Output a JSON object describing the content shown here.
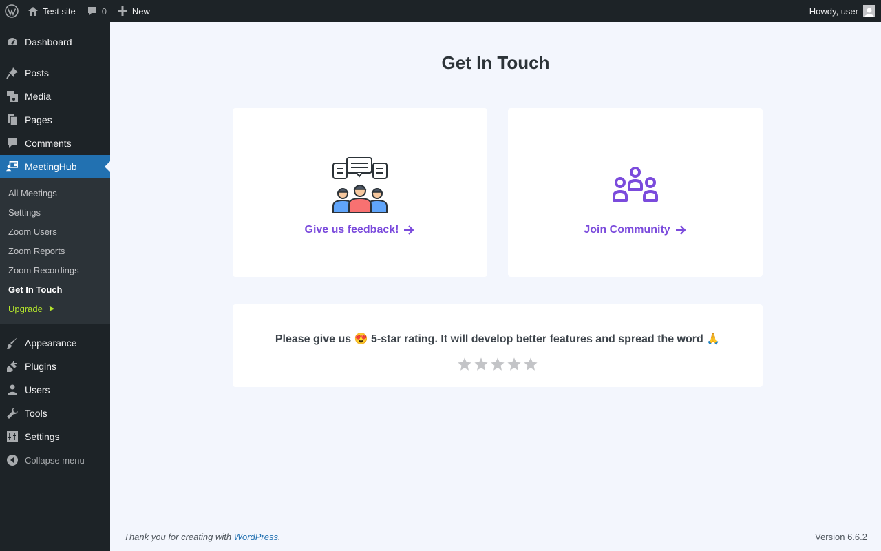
{
  "adminbar": {
    "site_name": "Test site",
    "comments_count": "0",
    "new_label": "New",
    "howdy": "Howdy, user"
  },
  "sidebar": {
    "items_top": [
      {
        "label": "Dashboard",
        "icon": "dashboard-icon"
      }
    ],
    "items_mid": [
      {
        "label": "Posts",
        "icon": "pin-icon"
      },
      {
        "label": "Media",
        "icon": "media-icon"
      },
      {
        "label": "Pages",
        "icon": "pages-icon"
      },
      {
        "label": "Comments",
        "icon": "comment-icon"
      },
      {
        "label": "MeetingHub",
        "icon": "meetinghub-icon"
      }
    ],
    "submenu": [
      {
        "label": "All Meetings"
      },
      {
        "label": "Settings"
      },
      {
        "label": "Zoom Users"
      },
      {
        "label": "Zoom Reports"
      },
      {
        "label": "Zoom Recordings"
      },
      {
        "label": "Get In Touch"
      },
      {
        "label": "Upgrade"
      }
    ],
    "items_bottom": [
      {
        "label": "Appearance",
        "icon": "brush-icon"
      },
      {
        "label": "Plugins",
        "icon": "plugin-icon"
      },
      {
        "label": "Users",
        "icon": "user-icon"
      },
      {
        "label": "Tools",
        "icon": "wrench-icon"
      },
      {
        "label": "Settings",
        "icon": "settings-icon"
      }
    ],
    "collapse_label": "Collapse menu",
    "upgrade_arrow": "➤"
  },
  "main": {
    "title": "Get In Touch",
    "feedback_link": "Give us feedback!",
    "community_link": "Join Community",
    "rating_text_before": "Please give us",
    "rating_emoji_love": "😍",
    "rating_text_after": "5-star rating. It will develop better features and spread the word",
    "rating_emoji_pray": "🙏",
    "stars_filled": 0,
    "stars_total": 5
  },
  "footer": {
    "thanks_before": "Thank you for creating with ",
    "wp_link": "WordPress",
    "thanks_after": ".",
    "version": "Version 6.6.2"
  },
  "colors": {
    "accent": "#7b4bdc",
    "menu_active": "#2271b1",
    "upgrade": "#b4e52c"
  }
}
